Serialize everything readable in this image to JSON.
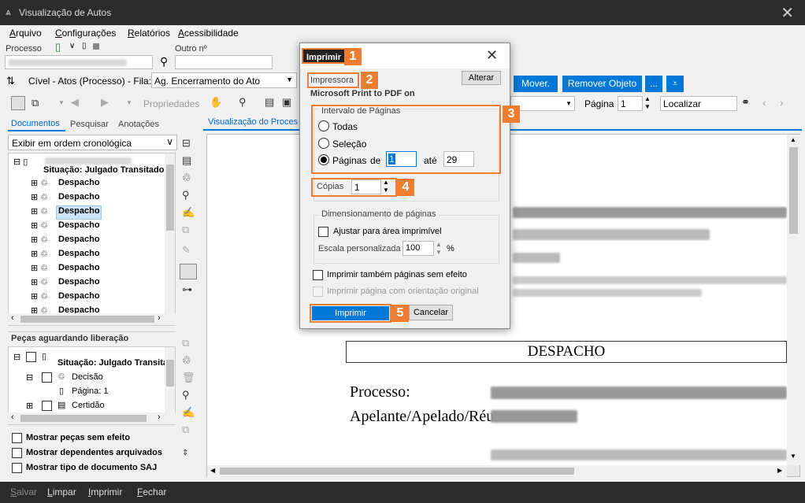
{
  "window": {
    "title": "Visualização de Autos"
  },
  "menu": [
    "Arquivo",
    "Configurações",
    "Relatórios",
    "Acessibilidade"
  ],
  "filter": {
    "processo_label": "Processo",
    "outro_label": "Outro nº",
    "category": "Cível - Atos (Processo) - Fila:",
    "queue_value": "Ag. Encerramento do Ato"
  },
  "toolbar": {
    "propriedades": "Propriedades"
  },
  "left_tabs": [
    "Documentos",
    "Pesquisar",
    "Anotações"
  ],
  "order_select": "Exibir em ordem cronológica",
  "tree": {
    "root": "Situação: Julgado Transitado",
    "items": [
      "Despacho",
      "Despacho",
      "Despacho",
      "Despacho",
      "Despacho",
      "Despacho",
      "Despacho",
      "Despacho",
      "Despacho",
      "Despacho"
    ]
  },
  "pending": {
    "title": "Peças aguardando liberação",
    "root": "Situação: Julgado Transita",
    "decisao": "Decisão",
    "pagina": "Página: 1",
    "certidao": "Certidão"
  },
  "checkboxes": [
    "Mostrar peças sem efeito",
    "Mostrar dependentes arquivados",
    "Mostrar tipo de documento SAJ"
  ],
  "viewer": {
    "tab": "Visualização do Proces",
    "move_btn": "Mover.",
    "remove_btn": "Remover Objeto",
    "more_btn": "...",
    "page_label": "Página",
    "page_value": "1",
    "find_placeholder": "Localizar",
    "doc_header": "DESPACHO",
    "processo": "Processo:",
    "apelante": "Apelante/Apelado/Réu:"
  },
  "bottom": [
    "Salvar",
    "Limpar",
    "Imprimir",
    "Fechar"
  ],
  "dialog": {
    "title": "Imprimir",
    "printer_label": "Impressora",
    "printer_name": "Microsoft Print to PDF on",
    "alterar": "Alterar",
    "range_group": "Intervalo de Páginas",
    "todas": "Todas",
    "selecao": "Seleção",
    "paginas": "Páginas",
    "de": "de",
    "de_value": "1",
    "ate": "até",
    "ate_value": "29",
    "copias_label": "Cópias",
    "copias_value": "1",
    "sizing_group": "Dimensionamento de páginas",
    "ajustar": "Ajustar para área imprimível",
    "escala": "Escala personalizada",
    "escala_value": "100",
    "percent": "%",
    "sem_efeito": "Imprimir também páginas sem efeito",
    "orientacao": "Imprimir página com orientação original",
    "imprimir_btn": "Imprimir",
    "cancelar_btn": "Cancelar"
  },
  "callouts": [
    "1",
    "2",
    "3",
    "4",
    "5"
  ],
  "colors": {
    "accent": "#0078d7",
    "callout": "#ed7d31",
    "titlebar": "#2b2b2b"
  }
}
